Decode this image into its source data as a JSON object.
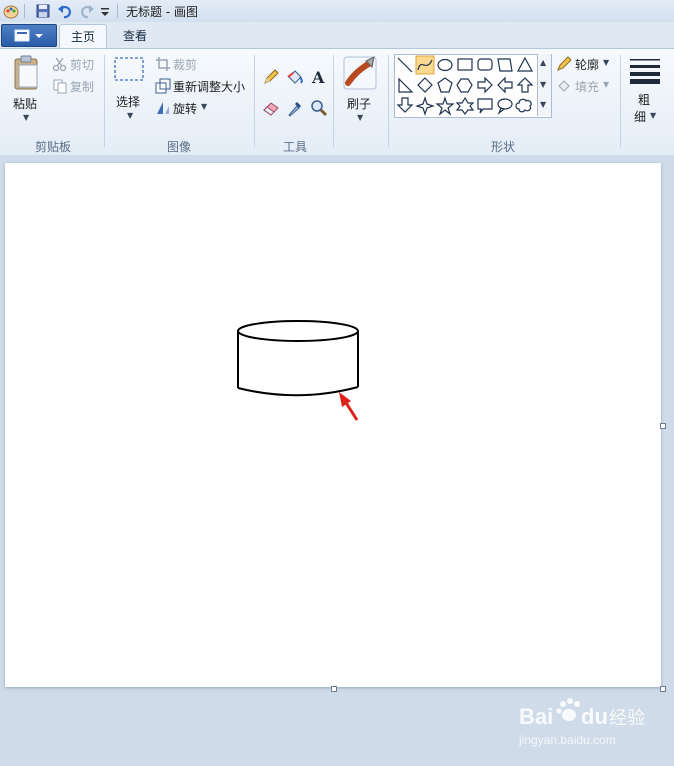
{
  "window": {
    "title": "无标题 - 画图"
  },
  "tabs": {
    "home": "主页",
    "view": "查看"
  },
  "clipboard": {
    "paste": "粘贴",
    "cut": "剪切",
    "copy": "复制",
    "group": "剪贴板"
  },
  "image": {
    "select": "选择",
    "crop": "裁剪",
    "resize": "重新调整大小",
    "rotate": "旋转",
    "group": "图像"
  },
  "tools": {
    "group": "工具"
  },
  "brushes": {
    "label": "刷子"
  },
  "shapes": {
    "outline": "轮廓",
    "fill": "填充",
    "group": "形状",
    "selected": "curve"
  },
  "size": {
    "label_line1": "粗",
    "label_line2": "细"
  },
  "watermark": {
    "brand": "Bai",
    "brand2": "du",
    "jingyan": "经验",
    "url": "jingyan.baidu.com"
  },
  "colors": {
    "accent": "#2a5ca8",
    "annotation_arrow": "#e0201b",
    "selected_shape": "#fbd98f"
  }
}
